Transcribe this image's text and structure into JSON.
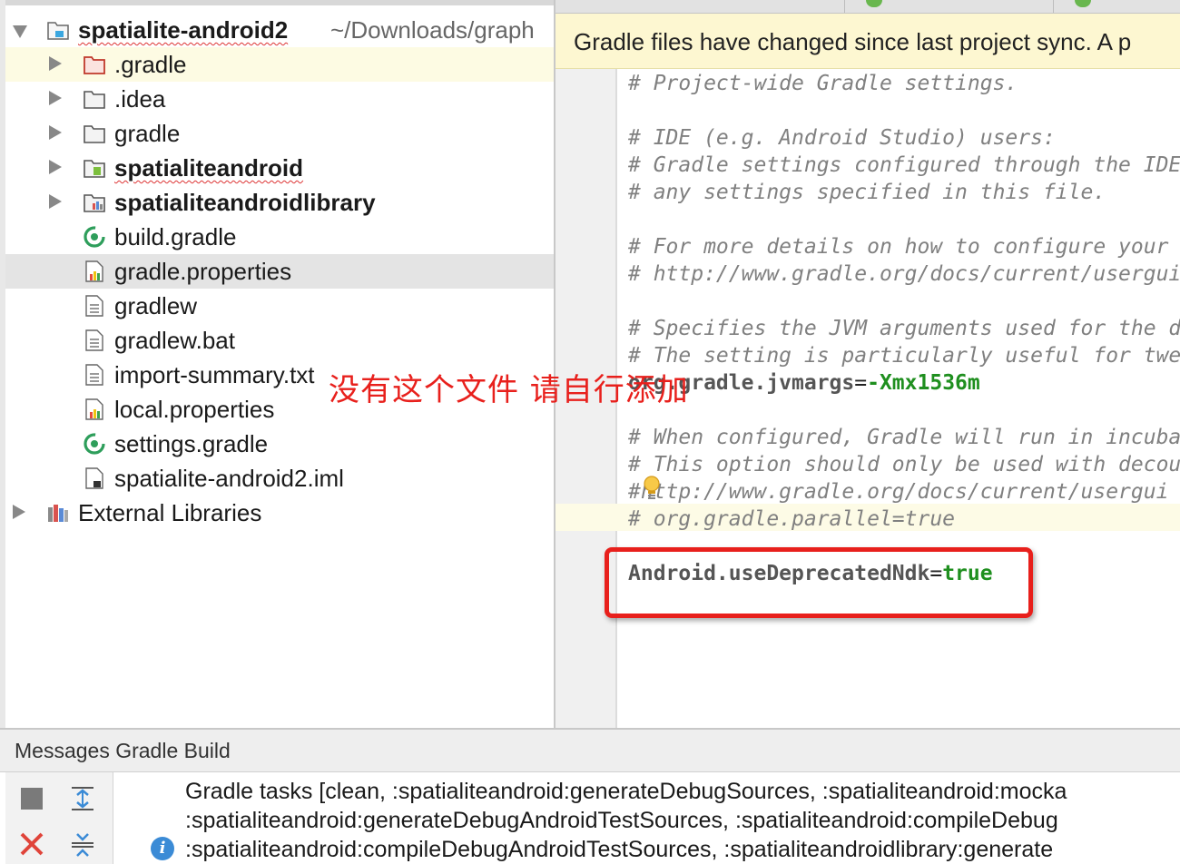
{
  "project_tree": {
    "root": {
      "name": "spatialite-android2",
      "path": "~/Downloads/graph"
    },
    "items": [
      {
        "label": ".gradle",
        "kind": "folder-red"
      },
      {
        "label": ".idea",
        "kind": "folder"
      },
      {
        "label": "gradle",
        "kind": "folder"
      },
      {
        "label": "spatialiteandroid",
        "kind": "module-android"
      },
      {
        "label": "spatialiteandroidlibrary",
        "kind": "module-lib"
      },
      {
        "label": "build.gradle",
        "kind": "gradle-file"
      },
      {
        "label": "gradle.properties",
        "kind": "properties-file"
      },
      {
        "label": "gradlew",
        "kind": "text-file"
      },
      {
        "label": "gradlew.bat",
        "kind": "text-file"
      },
      {
        "label": "import-summary.txt",
        "kind": "text-file"
      },
      {
        "label": "local.properties",
        "kind": "properties-file"
      },
      {
        "label": "settings.gradle",
        "kind": "gradle-file"
      },
      {
        "label": "spatialite-android2.iml",
        "kind": "iml-file"
      }
    ],
    "external": "External Libraries"
  },
  "overlay_note": "没有这个文件  请自行添加",
  "editor": {
    "banner": "Gradle files have changed since last project sync. A p",
    "lines": [
      "# Project-wide Gradle settings.",
      "# IDE (e.g. Android Studio) users:",
      "# Gradle settings configured through the IDE",
      "# any settings specified in this file.",
      "# For more details on how to configure your",
      "# http://www.gradle.org/docs/current/usergui",
      "# Specifies the JVM arguments used for the d",
      "# The setting is particularly useful for twe",
      "# When configured, Gradle will run in incuba",
      "# This option should only be used with decou",
      "#http://www.gradle.org/docs/current/usergui",
      "# org.gradle.parallel=true"
    ],
    "jvmargs": {
      "key": "org.gradle.jvmargs",
      "eq": "=",
      "value": "-Xmx1536m"
    },
    "ndk": {
      "key": "Android.useDeprecatedNdk",
      "eq": "=",
      "value": "true"
    }
  },
  "messages": {
    "header": "Messages Gradle Build",
    "lines": [
      "Gradle tasks [clean, :spatialiteandroid:generateDebugSources, :spatialiteandroid:mocka",
      ":spatialiteandroid:generateDebugAndroidTestSources, :spatialiteandroid:compileDebug",
      ":spatialiteandroid:compileDebugAndroidTestSources, :spatialiteandroidlibrary:generate"
    ],
    "info_glyph": "i"
  },
  "colors": {
    "annotation_red": "#e8201c",
    "property_value": "#1f8f1f",
    "banner_bg": "#fdf7d1"
  }
}
